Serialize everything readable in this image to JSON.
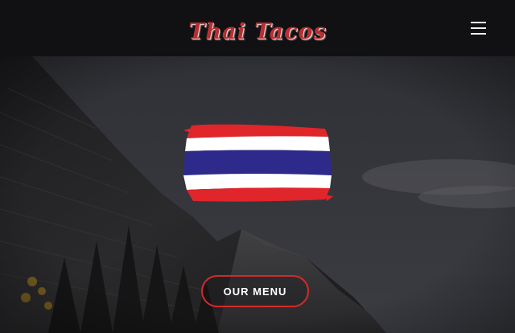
{
  "header": {
    "logo_text": "Thai Tacos",
    "menu_icon": "hamburger-menu-icon"
  },
  "hero": {
    "background": "mountain-night-photo",
    "flag": "thailand-flag-brush",
    "cta_label": "OUR MENU"
  },
  "colors": {
    "header_bg": "#111113",
    "logo_red": "#b92e33",
    "cta_border": "#d42a2a",
    "flag_red": "#e0252b",
    "flag_white": "#ffffff",
    "flag_blue": "#2d2a8c"
  }
}
